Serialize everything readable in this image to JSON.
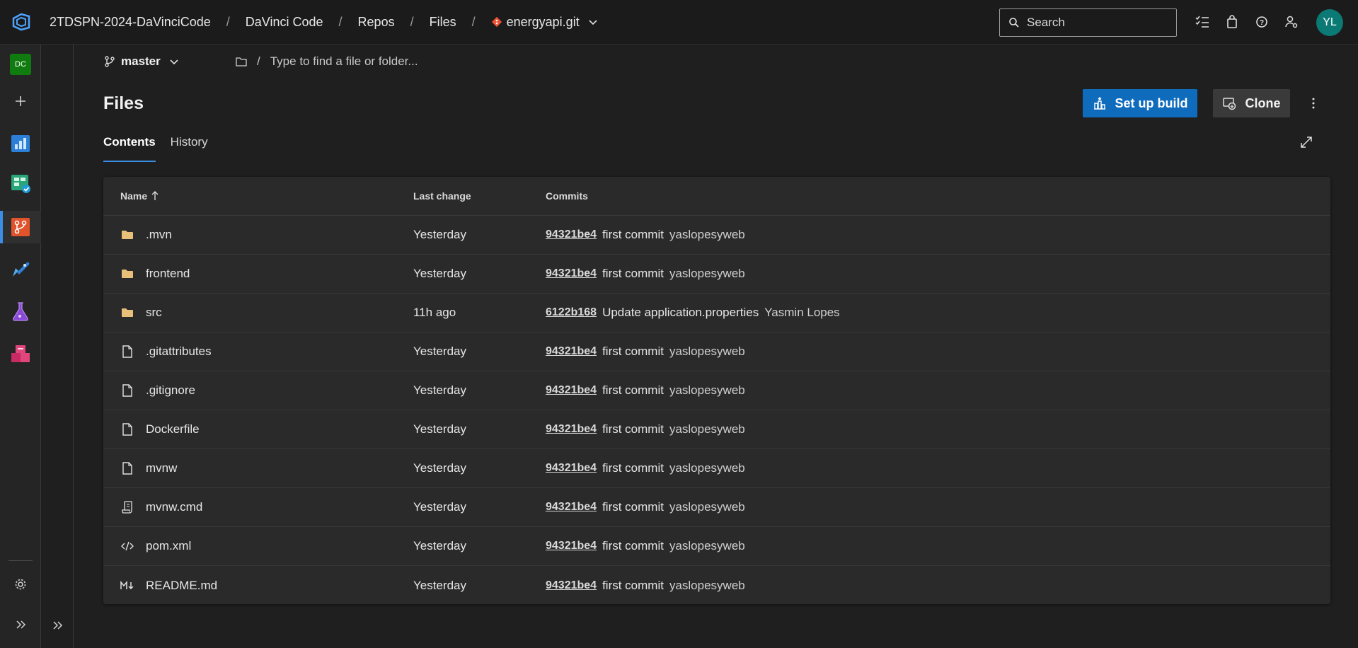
{
  "breadcrumb": {
    "org": "2TDSPN-2024-DaVinciCode",
    "project": "DaVinci Code",
    "section": "Repos",
    "page": "Files",
    "repo": "energyapi.git"
  },
  "search": {
    "placeholder": "Search"
  },
  "user": {
    "initials": "YL"
  },
  "project_badge": "DC",
  "branch": {
    "name": "master"
  },
  "path": {
    "placeholder": "Type to find a file or folder..."
  },
  "page_title": "Files",
  "buttons": {
    "setup_build": "Set up build",
    "clone": "Clone"
  },
  "tabs": [
    {
      "label": "Contents"
    },
    {
      "label": "History"
    }
  ],
  "table": {
    "headers": {
      "name": "Name",
      "last_change": "Last change",
      "commits": "Commits"
    },
    "rows": [
      {
        "icon": "folder-icon",
        "name": ".mvn",
        "last_change": "Yesterday",
        "commit_id": "94321be4",
        "message": "first commit",
        "author": "yaslopesyweb"
      },
      {
        "icon": "folder-icon",
        "name": "frontend",
        "last_change": "Yesterday",
        "commit_id": "94321be4",
        "message": "first commit",
        "author": "yaslopesyweb"
      },
      {
        "icon": "folder-icon",
        "name": "src",
        "last_change": "11h ago",
        "commit_id": "6122b168",
        "message": "Update application.properties",
        "author": "Yasmin Lopes"
      },
      {
        "icon": "file-icon",
        "name": ".gitattributes",
        "last_change": "Yesterday",
        "commit_id": "94321be4",
        "message": "first commit",
        "author": "yaslopesyweb"
      },
      {
        "icon": "file-icon",
        "name": ".gitignore",
        "last_change": "Yesterday",
        "commit_id": "94321be4",
        "message": "first commit",
        "author": "yaslopesyweb"
      },
      {
        "icon": "file-icon",
        "name": "Dockerfile",
        "last_change": "Yesterday",
        "commit_id": "94321be4",
        "message": "first commit",
        "author": "yaslopesyweb"
      },
      {
        "icon": "file-icon",
        "name": "mvnw",
        "last_change": "Yesterday",
        "commit_id": "94321be4",
        "message": "first commit",
        "author": "yaslopesyweb"
      },
      {
        "icon": "script-icon",
        "name": "mvnw.cmd",
        "last_change": "Yesterday",
        "commit_id": "94321be4",
        "message": "first commit",
        "author": "yaslopesyweb"
      },
      {
        "icon": "code-icon",
        "name": "pom.xml",
        "last_change": "Yesterday",
        "commit_id": "94321be4",
        "message": "first commit",
        "author": "yaslopesyweb"
      },
      {
        "icon": "markdown-icon",
        "name": "README.md",
        "last_change": "Yesterday",
        "commit_id": "94321be4",
        "message": "first commit",
        "author": "yaslopesyweb"
      }
    ]
  },
  "colors": {
    "accent": "#0f6cbd",
    "folder": "#e8c07a",
    "avatar": "#0b7a75"
  }
}
